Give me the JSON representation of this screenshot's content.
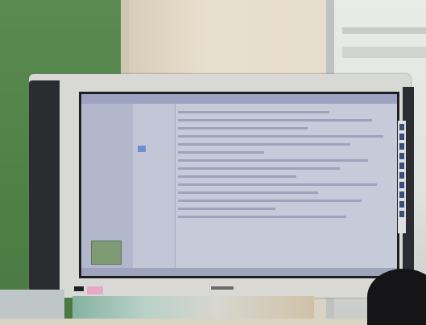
{
  "scene": {
    "subject": "",
    "colors": {
      "wall_green": "#5a8a4f",
      "bezel": "#d8d8d4",
      "screen": "#c7cad9",
      "screen_toolbar": "#9ea3c1",
      "foreground_head": "#151517"
    }
  }
}
